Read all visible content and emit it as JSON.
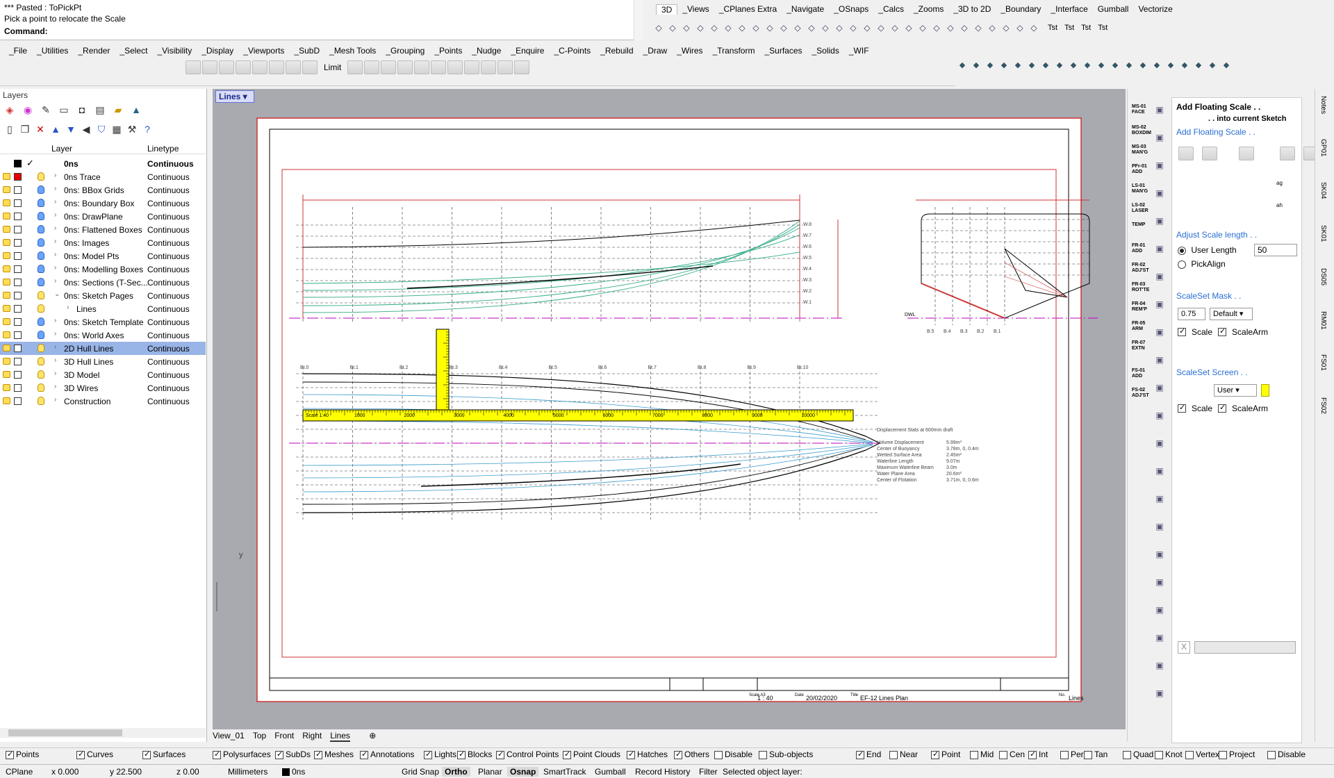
{
  "command": {
    "line1": "*** Pasted : ToPickPt",
    "line2": "Pick a point to relocate the Scale",
    "prompt": "Command:"
  },
  "top_tabs": [
    "3D",
    "_Views",
    "_CPlanes Extra",
    "_Navigate",
    "_OSnaps",
    "_Calcs",
    "_Zooms",
    "_3D to 2D",
    "_Boundary",
    "_Interface",
    "Gumball",
    "Vectorize"
  ],
  "tst_labels": [
    "Tst",
    "Tst",
    "Tst",
    "Tst"
  ],
  "main_tabs": [
    "_File",
    "_Utilities",
    "_Render",
    "_Select",
    "_Visibility",
    "_Display",
    "_Viewports",
    "_SubD",
    "_Mesh Tools",
    "_Grouping",
    "_Points",
    "_Nudge",
    "_Enquire",
    "_C-Points",
    "_Rebuild",
    "_Draw",
    "_Wires",
    "_Transform",
    "_Surfaces",
    "_Solids",
    "_WIF"
  ],
  "limit_label": "Limit",
  "layers": {
    "title": "Layers",
    "col_layer": "Layer",
    "col_linetype": "Linetype",
    "rows": [
      {
        "name": "0ns",
        "ltype": "Continuous",
        "bold": true
      },
      {
        "name": "0ns Trace",
        "ltype": "Continuous"
      },
      {
        "name": "0ns: BBox Grids",
        "ltype": "Continuous"
      },
      {
        "name": "0ns: Boundary Box",
        "ltype": "Continuous"
      },
      {
        "name": "0ns: DrawPlane",
        "ltype": "Continuous"
      },
      {
        "name": "0ns: Flattened Boxes",
        "ltype": "Continuous"
      },
      {
        "name": "0ns: Images",
        "ltype": "Continuous"
      },
      {
        "name": "0ns: Model Pts",
        "ltype": "Continuous"
      },
      {
        "name": "0ns: Modelling Boxes",
        "ltype": "Continuous"
      },
      {
        "name": "0ns: Sections (T-Sec...",
        "ltype": "Continuous"
      },
      {
        "name": "0ns: Sketch Pages",
        "ltype": "Continuous"
      },
      {
        "name": "Lines",
        "ltype": "Continuous"
      },
      {
        "name": "0ns: Sketch Template",
        "ltype": "Continuous"
      },
      {
        "name": "0ns: World Axes",
        "ltype": "Continuous"
      },
      {
        "name": "2D Hull Lines",
        "ltype": "Continuous"
      },
      {
        "name": "3D Hull Lines",
        "ltype": "Continuous"
      },
      {
        "name": "3D Model",
        "ltype": "Continuous"
      },
      {
        "name": "3D Wires",
        "ltype": "Continuous"
      },
      {
        "name": "Construction",
        "ltype": "Continuous"
      }
    ]
  },
  "viewport": {
    "tab": "Lines",
    "titleblock": {
      "scale_label": "Scale A3",
      "scale": "1 : 40",
      "date_label": "Date",
      "date": "20/02/2020",
      "title_label": "Title",
      "title": "EF-12 Lines Plan",
      "no_label": "No.",
      "no": "Lines"
    },
    "stats_title": "Displacement Stats at 600mm draft",
    "stats": [
      {
        "k": "Volume Displacement",
        "v": "5.99m³"
      },
      {
        "k": "Center of Buoyancy",
        "v": "3.78m, 0, 0.4m"
      },
      {
        "k": "Wetted Surface Area",
        "v": "2.45m²"
      },
      {
        "k": "Waterline Length",
        "v": "9.07m"
      },
      {
        "k": "Maximum Waterline Beam",
        "v": "3.0m"
      },
      {
        "k": "Water Plane Area",
        "v": "20.6m²"
      },
      {
        "k": "Center of Flotation",
        "v": "3.71m, 0, 0.6m"
      }
    ],
    "stations": [
      "Bt.0",
      "Bt.1",
      "Bt.2",
      "Bt.3",
      "Bt.4",
      "Bt.5",
      "Bt.6",
      "Bt.7",
      "Bt.8",
      "Bt.9",
      "Bt.10"
    ],
    "waterlines": [
      "W.8",
      "W.7",
      "W.6",
      "W.5",
      "W.4",
      "W.3",
      "W.2",
      "W.1"
    ],
    "buttocks": [
      "B.5",
      "B.4",
      "B.3",
      "B.2",
      "B.1"
    ],
    "dwl_label": "DWL",
    "ruler_label": "Scale 1:40",
    "ruler_marks": [
      "1000",
      "2000",
      "3000",
      "4000",
      "5000",
      "6000",
      "7000",
      "8000",
      "9000",
      "10000"
    ],
    "axis_label": "y"
  },
  "right_strip": [
    "MS-01 FACE",
    "MS-02 BOXDIM",
    "MS-03 MAN'G",
    "PFr-01 ADD",
    "LS-01 MAN'G",
    "LS-02 LASER",
    "TEMP",
    "FR-01 ADD",
    "FR-02 ADJ'ST",
    "FR-03 ROT'TE",
    "FR-04 REM'P",
    "FR-05 ARM",
    "FR-07 EXTN",
    "FS-01 ADD",
    "FS-02 ADJ'ST"
  ],
  "panel": {
    "title": "Add Floating Scale . .",
    "subtitle": ". . into current Sketch",
    "sec_add": "Add Floating Scale . .",
    "sec_adjust": "Adjust Scale length . .",
    "user_length_label": "User Length",
    "user_length_value": "50",
    "pickalign_label": "PickAlign",
    "sec_mask": "ScaleSet Mask . .",
    "mask_value": "0.75",
    "mask_select": "Default",
    "scale_label": "Scale",
    "scalearm_label": "ScaleArm",
    "sec_screen": "ScaleSet Screen . .",
    "screen_select": "User",
    "screen_color": "#ffff00",
    "close_x": "X"
  },
  "vtabs": [
    "Notes",
    "GP01",
    "SK04",
    "SK01",
    "DS05",
    "RM01",
    "FS01",
    "FS02"
  ],
  "viewport_tabs": [
    "View_01",
    "Top",
    "Front",
    "Right",
    "Lines"
  ],
  "filters": [
    {
      "label": "Points",
      "on": true
    },
    {
      "label": "Curves",
      "on": true
    },
    {
      "label": "Surfaces",
      "on": true
    },
    {
      "label": "Polysurfaces",
      "on": true
    },
    {
      "label": "SubDs",
      "on": true
    },
    {
      "label": "Meshes",
      "on": true
    },
    {
      "label": "Annotations",
      "on": true
    },
    {
      "label": "Lights",
      "on": true
    },
    {
      "label": "Blocks",
      "on": true
    },
    {
      "label": "Control Points",
      "on": true
    },
    {
      "label": "Point Clouds",
      "on": true
    },
    {
      "label": "Hatches",
      "on": true
    },
    {
      "label": "Others",
      "on": true
    },
    {
      "label": "Disable",
      "on": false
    },
    {
      "label": "Sub-objects",
      "on": false
    }
  ],
  "osnaps": [
    {
      "label": "End",
      "on": true
    },
    {
      "label": "Near",
      "on": false
    },
    {
      "label": "Point",
      "on": true
    },
    {
      "label": "Mid",
      "on": false
    },
    {
      "label": "Cen",
      "on": false
    },
    {
      "label": "Int",
      "on": true
    },
    {
      "label": "Perp",
      "on": false
    },
    {
      "label": "Tan",
      "on": false
    },
    {
      "label": "Quad",
      "on": false
    },
    {
      "label": "Knot",
      "on": false
    },
    {
      "label": "Vertex",
      "on": false
    },
    {
      "label": "Project",
      "on": false
    },
    {
      "label": "Disable",
      "on": false
    }
  ],
  "status": {
    "cplane": "CPlane",
    "x": "x 0.000",
    "y": "y 22.500",
    "z": "z 0.00",
    "units": "Millimeters",
    "layer": "0ns",
    "grid_snap": "Grid Snap",
    "ortho": "Ortho",
    "planar": "Planar",
    "osnap": "Osnap",
    "smarttrack": "SmartTrack",
    "gumball": "Gumball",
    "record": "Record History",
    "filter": "Filter",
    "message": "Selected object layer:"
  }
}
